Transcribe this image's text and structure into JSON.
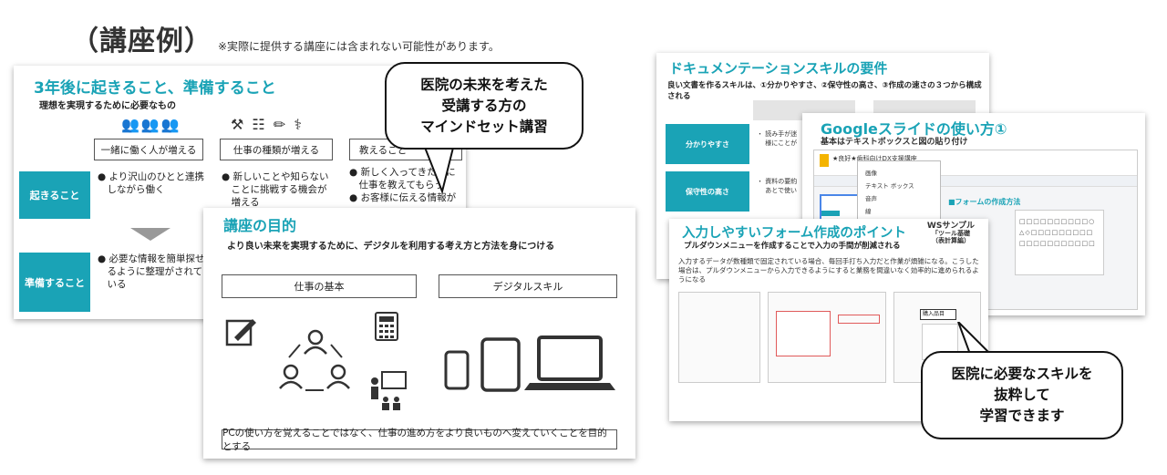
{
  "heading": {
    "main": "（講座例）",
    "note": "※実際に提供する講座には含まれない可能性があります。"
  },
  "slide1": {
    "title": "3年後に起きること、準備すること",
    "subtitle": "理想を実現するために必要なもの",
    "boxes": [
      "一緒に働く人が増える",
      "仕事の種類が増える",
      "教えること"
    ],
    "bullets": [
      "● より沢山のひとと連携\n　しながら働く",
      "● 新しいことや知らない\n　ことに挑戦する機会が\n　増える",
      "● 新しく入ってきた人に\n　仕事を教えてもらう\n● お客様に伝える情報が"
    ],
    "side_labels": [
      "起きること",
      "準備すること"
    ],
    "prep_text": "● 必要な情報を簡単探せ\n　るように整理がされて\n　いる",
    "icons": [
      "people-group-icon",
      "work-tools-icon"
    ]
  },
  "callout1": {
    "lines": [
      "医院の未来を考えた",
      "受講する方の",
      "マインドセット講習"
    ]
  },
  "slide2": {
    "title": "講座の目的",
    "subtitle": "より良い未来を実現するために、デジタルを利用する考え方と方法を身につける",
    "box_left": "仕事の基本",
    "box_right": "デジタルスキル",
    "footer": "PCの使い方を覚えることではなく、仕事の進め方をより良いものへ変えていくことを目的とする"
  },
  "slide3": {
    "title": "ドキュメンテーションスキルの要件",
    "subtitle": "良い文書を作るスキルは、①分かりやすさ、②保守性の高さ、③作成の速さの３つから構成される",
    "side_labels": [
      "分かりやすさ",
      "保守性の高さ"
    ],
    "texts": [
      "・ 読み手が迷\n　 様にことが",
      "・ 資料の要約\n　 あとで使い"
    ]
  },
  "slide4": {
    "title": "Googleスライドの使い方①",
    "subtitle": "基本はテキストボックスと図の貼り付け",
    "section": "■フォームの作成方法",
    "doc_title": "★良好★歯科向けDX支援講座",
    "menu_items": [
      "画像",
      "テキスト ボックス",
      "音声",
      "線",
      "図形"
    ]
  },
  "slide5": {
    "title": "入力しやすいフォーム作成のポイント",
    "subtitle": "プルダウンメニューを作成することで入力の手間が削減される",
    "badge_title": "WSサンプル",
    "badge_lines": [
      "「ツール基礎",
      "（表計算編）"
    ],
    "paragraph": "入力するデータが数種類で固定されている場合、毎回手打ち入力だと作業が煩雑になる。こうした場合は、プルダウンメニューから入力できるようにすると業務を間違いなく効率的に進められるようになる",
    "cell_value": "購入品目"
  },
  "callout2": {
    "lines": [
      "医院に必要なスキルを",
      "抜粋して",
      "学習できます"
    ]
  },
  "colors": {
    "accent": "#1aa3b6"
  }
}
